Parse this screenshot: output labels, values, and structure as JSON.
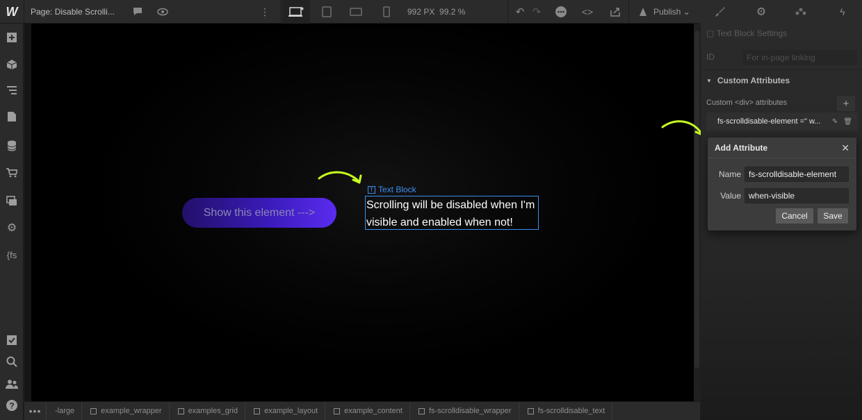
{
  "topbar": {
    "logo": "W",
    "page_prefix": "Page:",
    "page_name": "Disable Scrolli...",
    "size_px": "992 PX",
    "zoom": "99.2 %",
    "publish": "Publish"
  },
  "canvas": {
    "button_label": "Show this element --->",
    "selection_label": "Text Block",
    "text_block_line1": "Scrolling will be disabled when I'm",
    "text_block_line2": "visible and enabled when not!"
  },
  "breadcrumbs": [
    "-large",
    "example_wrapper",
    "examples_grid",
    "example_layout",
    "example_content",
    "fs-scrolldisable_wrapper",
    "fs-scrolldisable_text"
  ],
  "right_panel": {
    "settings_title": "Text Block Settings",
    "id_label": "ID",
    "id_placeholder": "For in-page linking",
    "custom_attributes_heading": "Custom Attributes",
    "custom_attributes_sub": "Custom <div> attributes",
    "attribute_row": "fs-scrolldisable-element =\" w..."
  },
  "modal": {
    "title": "Add Attribute",
    "name_label": "Name",
    "name_value": "fs-scrolldisable-element",
    "value_label": "Value",
    "value_value": "when-visible",
    "cancel": "Cancel",
    "save": "Save"
  },
  "colors": {
    "accent_blue": "#3d8ef0",
    "arrow_green": "#c8ff1e",
    "pill_gradient_start": "#22106a",
    "pill_gradient_end": "#5a2cf0"
  }
}
